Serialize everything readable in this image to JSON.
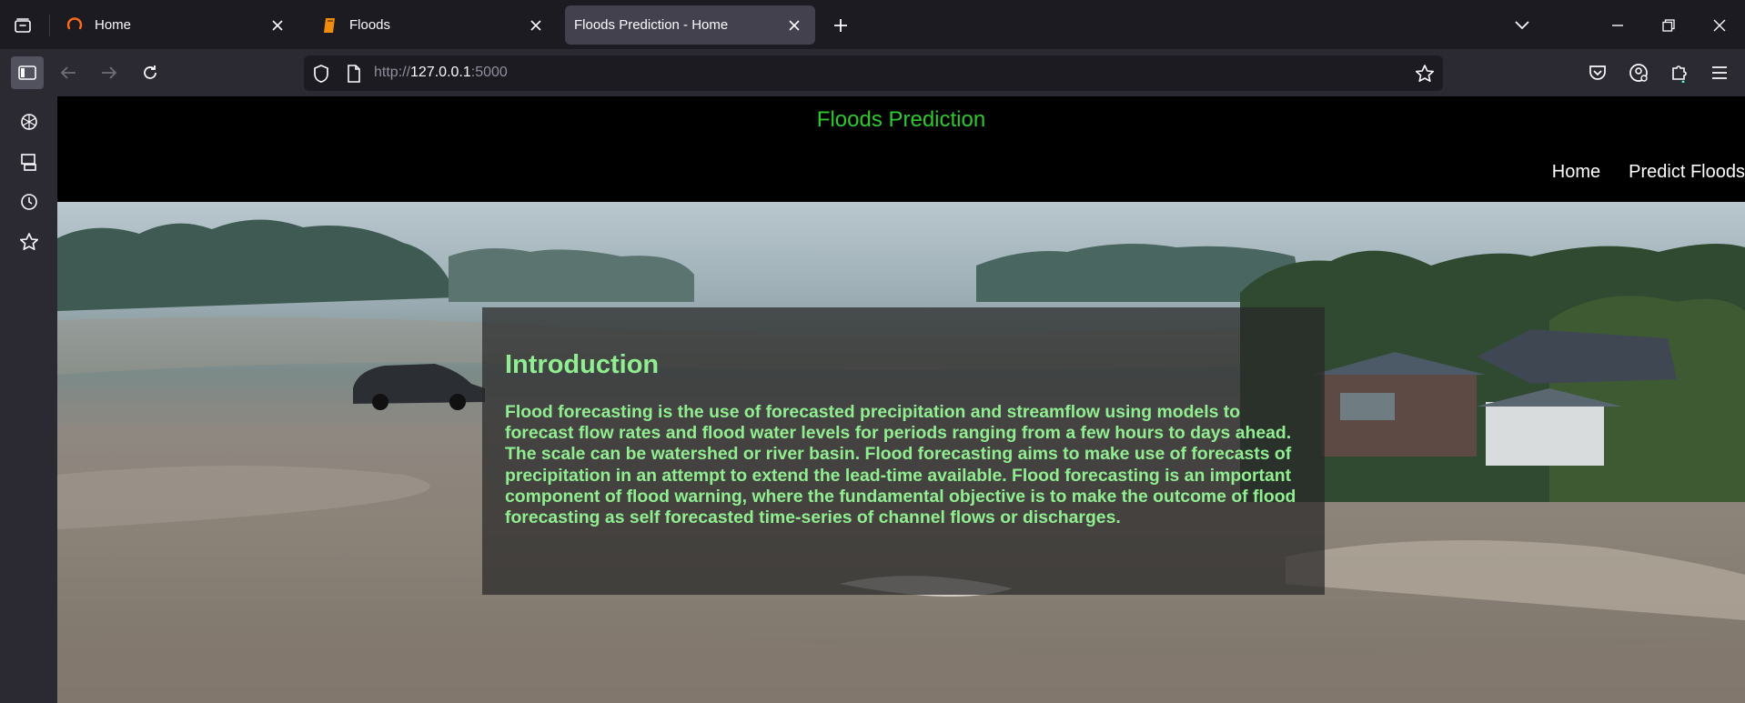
{
  "browser": {
    "tabs": [
      {
        "title": "Home",
        "icon": "firefox-spinner-icon",
        "active": false
      },
      {
        "title": "Floods",
        "icon": "notebook-icon",
        "active": false
      },
      {
        "title": "Floods Prediction - Home",
        "icon": "none",
        "active": true
      }
    ],
    "url": {
      "prefix": "http://",
      "host": "127.0.0.1",
      "port": ":5000"
    },
    "sidebar_icons": [
      "ai-chatbot-icon",
      "synced-tabs-icon",
      "history-icon",
      "bookmarks-icon"
    ]
  },
  "site": {
    "title": "Floods Prediction",
    "nav": [
      "Home",
      "Predict Floods"
    ]
  },
  "intro": {
    "heading": "Introduction",
    "body": "Flood forecasting is the use of forecasted precipitation and streamflow using models to forecast flow rates and flood water levels for periods ranging from a few hours to days ahead. The scale can be watershed or river basin. Flood forecasting aims to make use of forecasts of precipitation in an attempt to extend the lead-time available. Flood forecasting is an important component of flood warning, where the fundamental objective is to make the outcome of flood forecasting as self forecasted time-series of channel flows or discharges."
  },
  "colors": {
    "site_title": "#2ec82e",
    "intro_text": "#90ee90",
    "browser_chrome": "#1c1b22",
    "toolbar": "#2b2a33"
  }
}
